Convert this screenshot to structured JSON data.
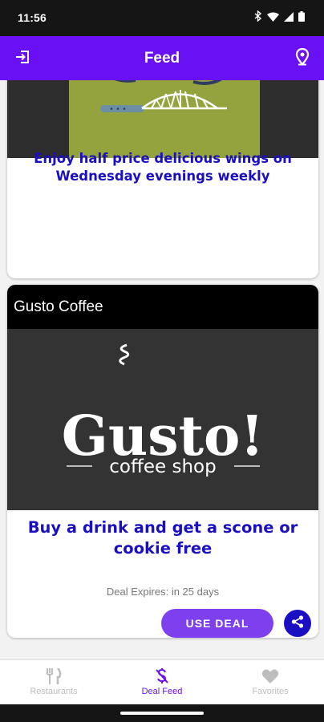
{
  "status_bar": {
    "time": "11:56"
  },
  "app_bar": {
    "title": "Feed"
  },
  "feed": {
    "cards": [
      {
        "deal_text": "Enjoy half price delicious wings on Wednesday evenings weekly"
      },
      {
        "restaurant_name": "Gusto Coffee",
        "logo_main": "Gusto!",
        "logo_sub": "coffee shop",
        "deal_text": "Buy a drink and get a scone or cookie free",
        "expires": "Deal Expires: in 25 days",
        "use_deal_label": "USE DEAL"
      }
    ]
  },
  "bottom_nav": {
    "items": [
      {
        "label": "Restaurants",
        "icon": "fork-knife-icon"
      },
      {
        "label": "Deal Feed",
        "icon": "dollar-strike-icon",
        "active": true
      },
      {
        "label": "Favorites",
        "icon": "heart-icon"
      }
    ]
  },
  "colors": {
    "primary": "#6a10f5",
    "deal_text": "#1a0fc2",
    "use_deal": "#7e3fee"
  }
}
